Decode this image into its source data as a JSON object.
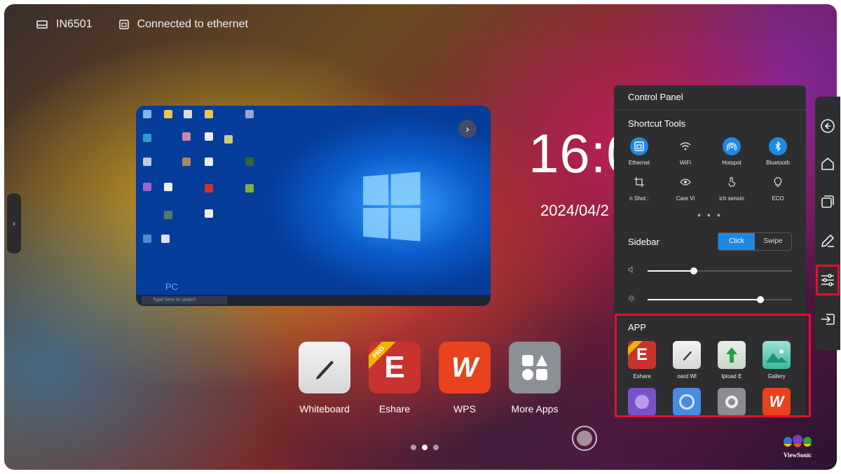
{
  "status_bar": {
    "device_name": "IN6501",
    "network_status": "Connected to ethernet"
  },
  "preview": {
    "source_label": "PC",
    "search_placeholder": "Type here to search"
  },
  "clock": {
    "time": "16:0",
    "date": "2024/04/2"
  },
  "dock": {
    "apps": [
      {
        "label": "Whiteboard"
      },
      {
        "label": "Eshare"
      },
      {
        "label": "WPS"
      },
      {
        "label": "More Apps"
      }
    ]
  },
  "control_panel": {
    "title": "Control Panel",
    "shortcut_title": "Shortcut Tools",
    "shortcuts": [
      {
        "label": "Ethernet",
        "icon": "ethernet-icon",
        "active": true
      },
      {
        "label": "WiFi",
        "icon": "wifi-icon",
        "active": false
      },
      {
        "label": "Hotspot",
        "icon": "hotspot-icon",
        "active": true
      },
      {
        "label": "Bluetooth",
        "icon": "bluetooth-icon",
        "active": true
      },
      {
        "label": "n Shot   :",
        "icon": "screenshot-icon",
        "active": false
      },
      {
        "label": "Care   Vi",
        "icon": "eye-care-icon",
        "active": false
      },
      {
        "label": "ich sensin",
        "icon": "touch-sensing-icon",
        "active": false
      },
      {
        "label": "ECO",
        "icon": "eco-bulb-icon",
        "active": false
      }
    ],
    "sidebar_label": "Sidebar",
    "sidebar_options": [
      "Click",
      "Swipe"
    ],
    "sidebar_selected": "Click",
    "volume_level": 0.32,
    "brightness_level": 0.78,
    "app_title": "APP",
    "apps": [
      {
        "label": "Eshare"
      },
      {
        "label": "oard   Wl"
      },
      {
        "label": "lpload   E"
      },
      {
        "label": "Gallery"
      },
      {
        "label": ""
      },
      {
        "label": ""
      },
      {
        "label": ""
      },
      {
        "label": ""
      }
    ]
  },
  "brand": "ViewSonic",
  "colors": {
    "accent": "#1e88e5",
    "highlight": "#e0122e"
  }
}
